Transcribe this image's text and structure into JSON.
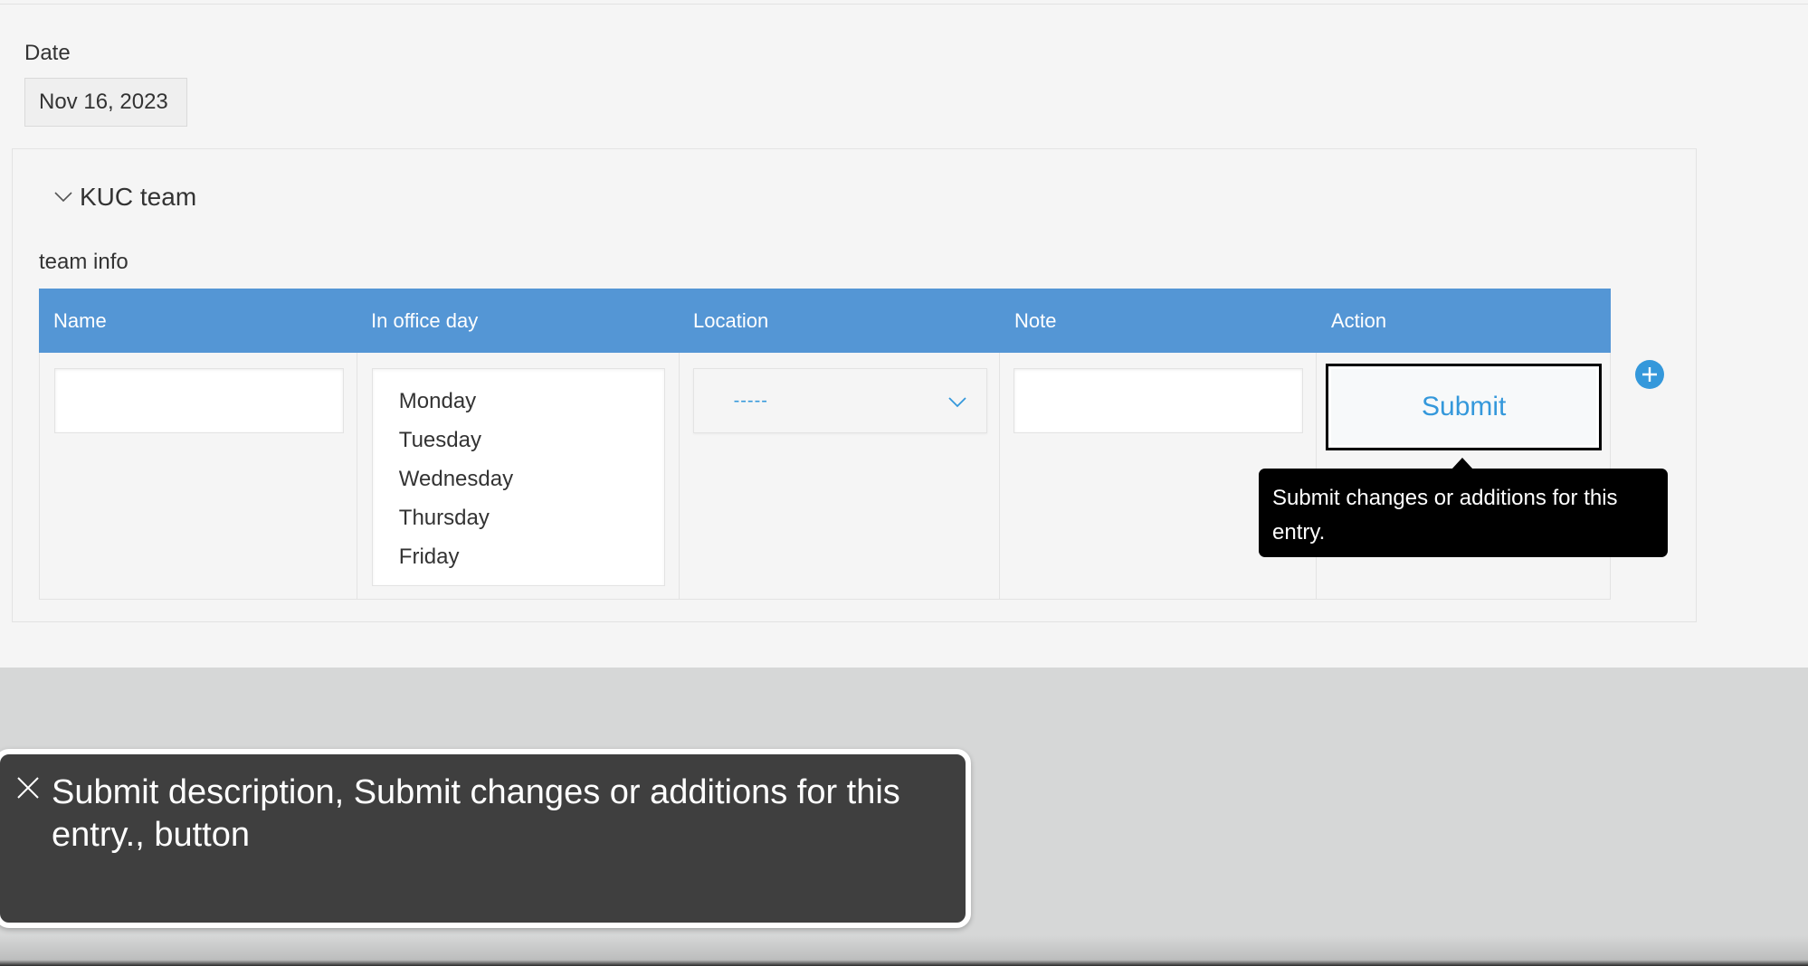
{
  "date_field": {
    "label": "Date",
    "value": "Nov 16, 2023"
  },
  "group": {
    "title": "KUC team",
    "expanded": true,
    "icon": "chevron-down-icon"
  },
  "subtable": {
    "label": "team info",
    "columns": [
      "Name",
      "In office day",
      "Location",
      "Note",
      "Action"
    ],
    "row": {
      "name_value": "",
      "in_office_day_options": [
        "Monday",
        "Tuesday",
        "Wednesday",
        "Thursday",
        "Friday"
      ],
      "location_value": "-----",
      "note_value": "",
      "action_label": "Submit"
    },
    "add_row_icon": "plus-circle-icon"
  },
  "tooltip": {
    "text": "Submit changes or additions for this entry."
  },
  "voiceover": {
    "caption": "Submit description, Submit changes or additions for this entry., button",
    "close_icon": "close-icon"
  },
  "colors": {
    "accent": "#3498db",
    "header_bg": "#5496d5",
    "page_bg": "#f5f5f5",
    "backdrop": "#d6d7d7",
    "tooltip_bg": "#000000",
    "voiceover_bg": "#3f3f3f"
  }
}
